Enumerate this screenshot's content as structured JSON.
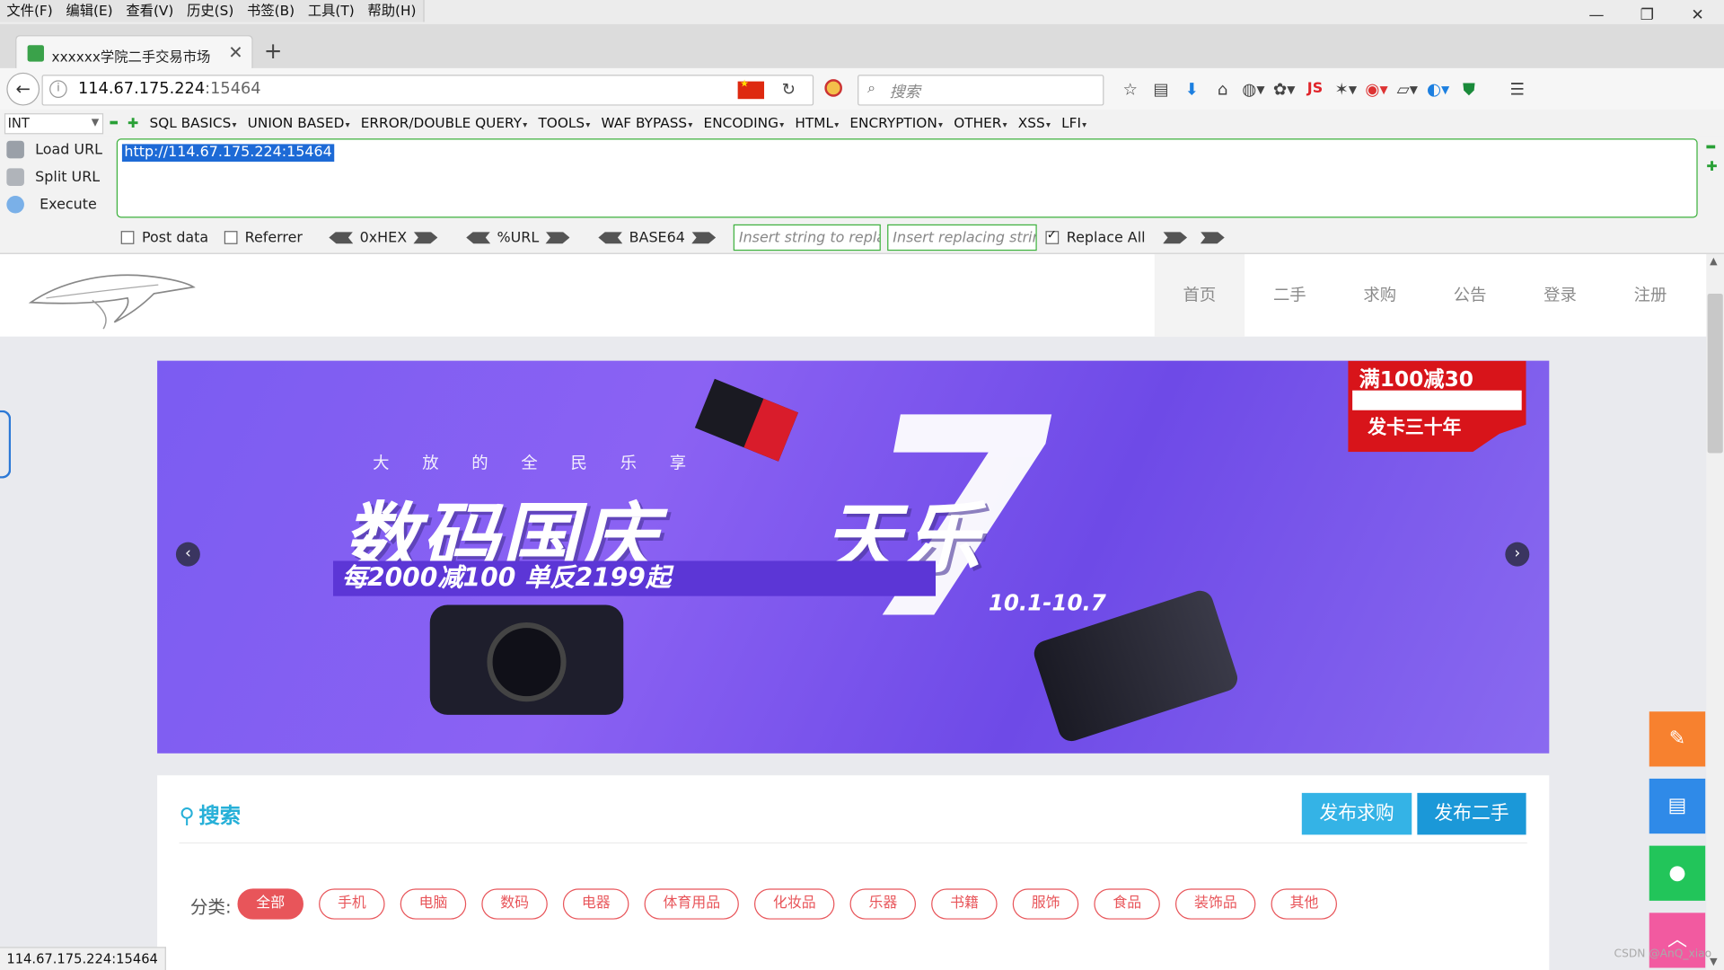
{
  "menubar": {
    "items": [
      "文件(F)",
      "编辑(E)",
      "查看(V)",
      "历史(S)",
      "书签(B)",
      "工具(T)",
      "帮助(H)"
    ],
    "window_controls": {
      "minimize": "—",
      "restore": "❐",
      "close": "✕"
    }
  },
  "tab": {
    "title": "xxxxxx学院二手交易市场",
    "close": "✕",
    "new_tab": "+"
  },
  "navbar": {
    "url_host": "114.67.175.224",
    "url_port": ":15464",
    "search_placeholder": "搜索",
    "js_label": "JS"
  },
  "hackbar": {
    "type_select": "INT",
    "menus": [
      "SQL BASICS",
      "UNION BASED",
      "ERROR/DOUBLE QUERY",
      "TOOLS",
      "WAF BYPASS",
      "ENCODING",
      "HTML",
      "ENCRYPTION",
      "OTHER",
      "XSS",
      "LFI"
    ],
    "actions": [
      "Load URL",
      "Split URL",
      "Execute"
    ],
    "url_value": "http://114.67.175.224:15464",
    "post_data": "Post data",
    "referrer": "Referrer",
    "encoders": [
      "0xHEX",
      "%URL",
      "BASE64"
    ],
    "insert_placeholder": "Insert string to replace",
    "replacing_placeholder": "Insert replacing string",
    "replace_all": "Replace All",
    "replace_all_checked": true
  },
  "site": {
    "nav": [
      "首页",
      "二手",
      "求购",
      "公告",
      "登录",
      "注册"
    ],
    "banner": {
      "subtitle": "大放的全民乐享",
      "title": "数码国庆",
      "seven": "7",
      "title_tail": "天乐",
      "slogan": "每2000减100 单反2199起",
      "dates": "10.1-10.7",
      "promo_top": "满100减30",
      "promo_bottom": "发卡三十年",
      "prev": "‹",
      "next": "›"
    },
    "search": {
      "title": "搜索",
      "buttons": [
        "发布求购",
        "发布二手"
      ],
      "category_label": "分类:",
      "categories": [
        "全部",
        "手机",
        "电脑",
        "数码",
        "电器",
        "体育用品",
        "化妆品",
        "乐器",
        "书籍",
        "服饰",
        "食品",
        "装饰品",
        "其他"
      ],
      "active_category": 0
    },
    "floating_buttons": [
      {
        "icon": "pencil-icon",
        "color": "#f7812f",
        "glyph": "✎"
      },
      {
        "icon": "notepad-icon",
        "color": "#2f8ae8",
        "glyph": "▤"
      },
      {
        "icon": "bell-icon",
        "color": "#22c55a",
        "glyph": "●"
      },
      {
        "icon": "arrow-up-icon",
        "color": "#f25aa0",
        "glyph": "︿"
      }
    ]
  },
  "statusbar": {
    "text": "114.67.175.224:15464"
  },
  "watermark": "CSDN @AnQ_xiao"
}
